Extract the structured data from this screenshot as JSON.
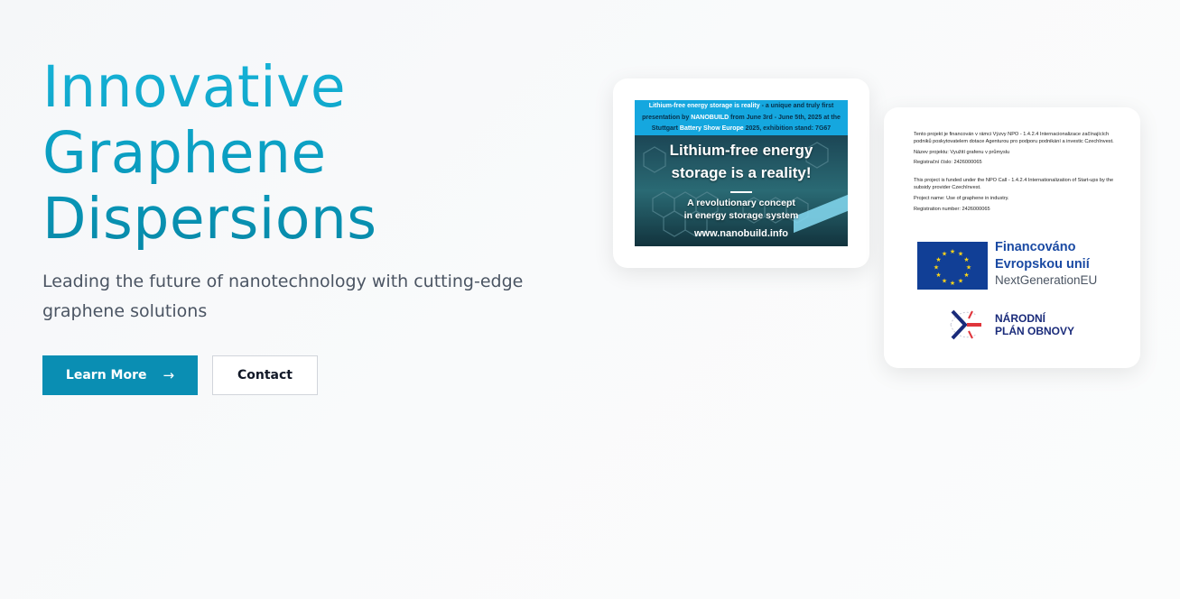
{
  "hero": {
    "title_lines": [
      "Innovative",
      "Graphene",
      "Dispersions"
    ],
    "subtitle": "Leading the future of nanotechnology with cutting-edge graphene solutions",
    "primary_button": "Learn More",
    "secondary_button": "Contact",
    "accent_color": "#0a8eb3"
  },
  "banner": {
    "head": {
      "t1": "Lithium-free energy storage is reality",
      "t2": " - a unique and truly first",
      "t3": "presentation by ",
      "t4": "NANOBUILD",
      "t5": " from June 3rd - June 5th, 2025 at the",
      "t6": "Stuttgart ",
      "t7": "Battery Show Europe",
      "t8": " 2025, exhibition stand: 7G67"
    },
    "headline_1": "Lithium-free energy",
    "headline_2": "storage is a reality!",
    "sub_1": "A revolutionary concept",
    "sub_2": "in energy storage system",
    "url": "www.nanobuild.info"
  },
  "funding": {
    "cz_1": "Tento projekt je financován v rámci Výzvy NPO - 1.4.2.4 Internacionalizace začínajících podniků poskytovatelem dotace Agenturou pro podporu podnikání a investic CzechInvest.",
    "cz_2": "Název projektu: Využití grafenu v průmyslu",
    "cz_3": "Registrační číslo: 2426000065",
    "en_1": "This project is funded under the NPO Call - 1.4.2.4 Internationalization of Start-ups by the subsidy provider CzechInvest.",
    "en_2": "Project name: Use of graphene in industry.",
    "en_3": "Registration number: 2426000065",
    "eu_1": "Financováno",
    "eu_2": "Evropskou unií",
    "eu_3": "NextGenerationEU",
    "npo_1": "NÁRODNÍ",
    "npo_2": "PLÁN OBNOVY"
  }
}
